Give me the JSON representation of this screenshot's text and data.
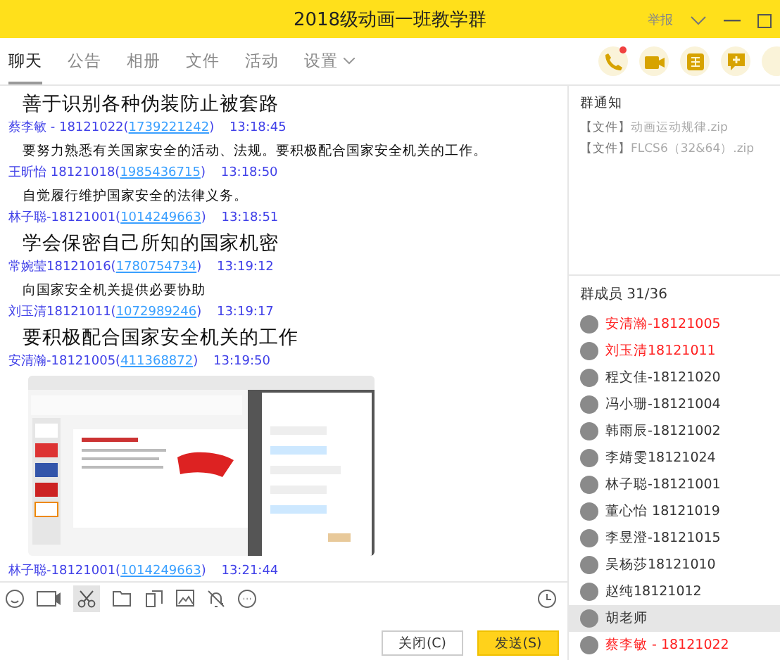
{
  "window": {
    "title": "2018级动画一班教学群",
    "report": "举报"
  },
  "tabs": [
    {
      "label": "聊天",
      "selected": true
    },
    {
      "label": "公告",
      "selected": false
    },
    {
      "label": "相册",
      "selected": false
    },
    {
      "label": "文件",
      "selected": false
    },
    {
      "label": "活动",
      "selected": false
    },
    {
      "label": "设置",
      "selected": false,
      "dropdown": true
    }
  ],
  "messages": [
    {
      "kind": "text",
      "large": true,
      "text": "善于识别各种伪装防止被套路"
    },
    {
      "kind": "header",
      "sender": "蔡李敏 - 18121022(",
      "qq": "1739221242",
      "qq_end": ")",
      "time": "13:18:45"
    },
    {
      "kind": "text",
      "large": false,
      "text": "要努力熟悉有关国家安全的活动、法规。要积极配合国家安全机关的工作。"
    },
    {
      "kind": "header",
      "sender": "王昕怡 18121018(",
      "qq": "1985436715",
      "qq_end": ")",
      "time": "13:18:50"
    },
    {
      "kind": "text",
      "large": false,
      "text": "自觉履行维护国家安全的法律义务。"
    },
    {
      "kind": "header",
      "sender": "林子聪-18121001(",
      "qq": "1014249663",
      "qq_end": ")",
      "time": "13:18:51"
    },
    {
      "kind": "text",
      "large": true,
      "text": "学会保密自己所知的国家机密"
    },
    {
      "kind": "header",
      "sender": "常婉莹18121016(",
      "qq": "1780754734",
      "qq_end": ")",
      "time": "13:19:12"
    },
    {
      "kind": "text",
      "large": false,
      "text": "向国家安全机关提供必要协助"
    },
    {
      "kind": "header",
      "sender": "刘玉清18121011(",
      "qq": "1072989246",
      "qq_end": ")",
      "time": "13:19:17"
    },
    {
      "kind": "text",
      "large": true,
      "text": "要积极配合国家安全机关的工作"
    },
    {
      "kind": "header",
      "sender": "安清瀚-18121005(",
      "qq": "411368872",
      "qq_end": ")",
      "time": "13:19:50"
    },
    {
      "kind": "image"
    },
    {
      "kind": "header",
      "sender": "林子聪-18121001(",
      "qq": "1014249663",
      "qq_end": ")",
      "time": "13:21:44"
    }
  ],
  "composer": {
    "buttons": [
      {
        "label": "关闭(C)",
        "primary": false
      },
      {
        "label": "发送(S)",
        "primary": true
      }
    ]
  },
  "notice": {
    "title": "群通知",
    "files": [
      {
        "tag": "【文件】",
        "name": "动画运动规律.zip"
      },
      {
        "tag": "【文件】",
        "name": "FLCS6（32&64）.zip"
      }
    ]
  },
  "members": {
    "title": "群成员 31/36",
    "items": [
      {
        "name": "安清瀚-18121005",
        "color": "#ff2020",
        "selected": false
      },
      {
        "name": "刘玉清18121011",
        "color": "#ff2020",
        "selected": false
      },
      {
        "name": "程文佳-18121020",
        "color": "#333333",
        "selected": false
      },
      {
        "name": "冯小珊-18121004",
        "color": "#333333",
        "selected": false
      },
      {
        "name": "韩雨辰-18121002",
        "color": "#333333",
        "selected": false
      },
      {
        "name": "李婧雯18121024",
        "color": "#333333",
        "selected": false
      },
      {
        "name": "林子聪-18121001",
        "color": "#333333",
        "selected": false
      },
      {
        "name": "董心怡 18121019",
        "color": "#333333",
        "selected": false
      },
      {
        "name": "李昱澄-18121015",
        "color": "#333333",
        "selected": false
      },
      {
        "name": "吴杨莎18121010",
        "color": "#333333",
        "selected": false
      },
      {
        "name": "赵纯18121012",
        "color": "#333333",
        "selected": false
      },
      {
        "name": "胡老师",
        "color": "#333333",
        "selected": true
      },
      {
        "name": "蔡李敏 - 18121022",
        "color": "#ff2020",
        "selected": false
      }
    ]
  }
}
